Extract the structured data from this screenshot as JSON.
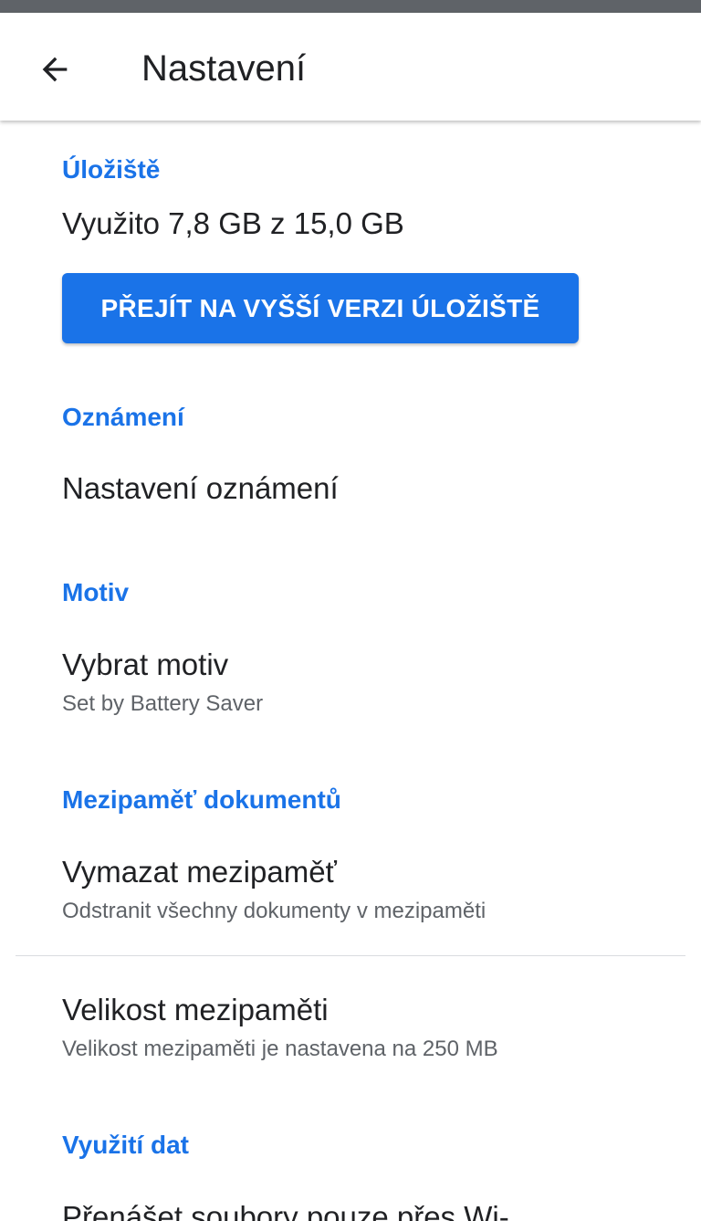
{
  "colors": {
    "accent": "#1a73e8",
    "text_primary": "#202124",
    "text_secondary": "#5f6368"
  },
  "header": {
    "back_icon": "arrow-left-icon",
    "title": "Nastavení"
  },
  "storage": {
    "header": "Úložiště",
    "usage": "Využito 7,8 GB z 15,0 GB",
    "upgrade_button": "PŘEJÍT NA VYŠŠÍ VERZI ÚLOŽIŠTĚ"
  },
  "notifications": {
    "header": "Oznámení",
    "settings_label": "Nastavení oznámení"
  },
  "theme": {
    "header": "Motiv",
    "choose_label": "Vybrat motiv",
    "choose_summary": "Set by Battery Saver"
  },
  "cache": {
    "header": "Mezipaměť dokumentů",
    "clear_label": "Vymazat mezipaměť",
    "clear_summary": "Odstranit všechny dokumenty v mezipaměti",
    "size_label": "Velikost mezipaměti",
    "size_summary": "Velikost mezipaměti je nastavena na 250 MB"
  },
  "data_usage": {
    "header": "Využití dat",
    "wifi_only_label": "Přenášet soubory pouze přes Wi-"
  }
}
